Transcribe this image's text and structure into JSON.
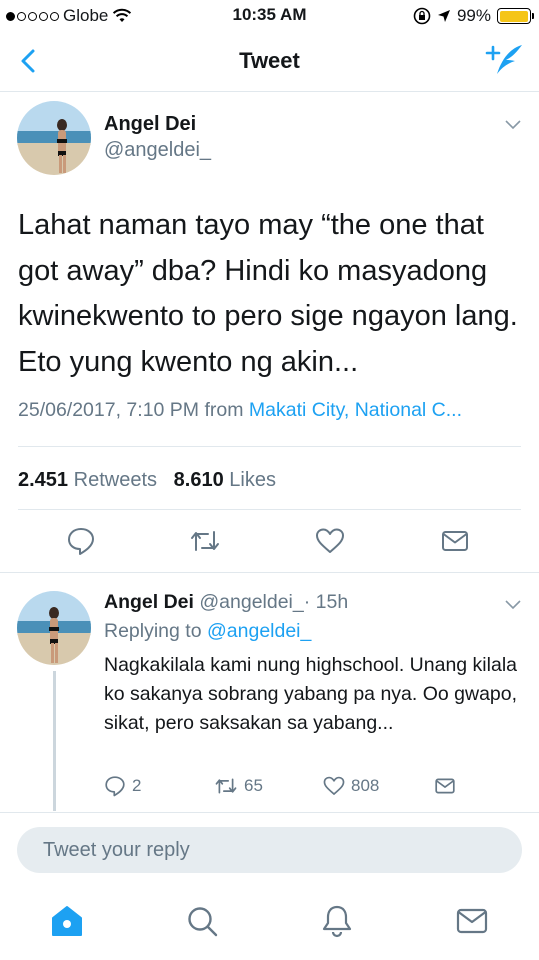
{
  "status_bar": {
    "carrier": "Globe",
    "time": "10:35 AM",
    "battery": "99%",
    "battery_level": 0.99
  },
  "nav": {
    "title": "Tweet",
    "back_icon": "chevron-left-icon",
    "compose_icon": "compose-tweet-icon"
  },
  "tweet": {
    "author_name": "Angel Dei",
    "author_handle": "@angeldei_",
    "text": "Lahat naman tayo may “the one that got away” dba? Hindi ko masyadong kwinekwento to pero sige ngayon lang. Eto yung kwento ng akin...",
    "date": "25/06/2017, 7:10 PM from ",
    "location": "Makati City, National C...",
    "retweets_count": "2.451",
    "retweets_label": "Retweets",
    "likes_count": "8.610",
    "likes_label": "Likes"
  },
  "reply": {
    "author_name": "Angel Dei",
    "author_handle": "@angeldei_",
    "time_ago": "· 15h",
    "replying_label": "Replying to ",
    "replying_handle": "@angeldei_",
    "text": "Nagkakilala kami nung highschool. Unang kilala ko sakanya sobrang yabang pa nya. Oo gwapo, sikat, pero saksakan sa yabang...",
    "reply_count": "2",
    "retweet_count": "65",
    "like_count": "808"
  },
  "reply_bar": {
    "placeholder": "Tweet your reply"
  },
  "colors": {
    "accent": "#1da1f2",
    "secondary_text": "#657786",
    "divider": "#e1e8ed",
    "input_bg": "#e6ecf0",
    "battery": "#f5c518"
  }
}
